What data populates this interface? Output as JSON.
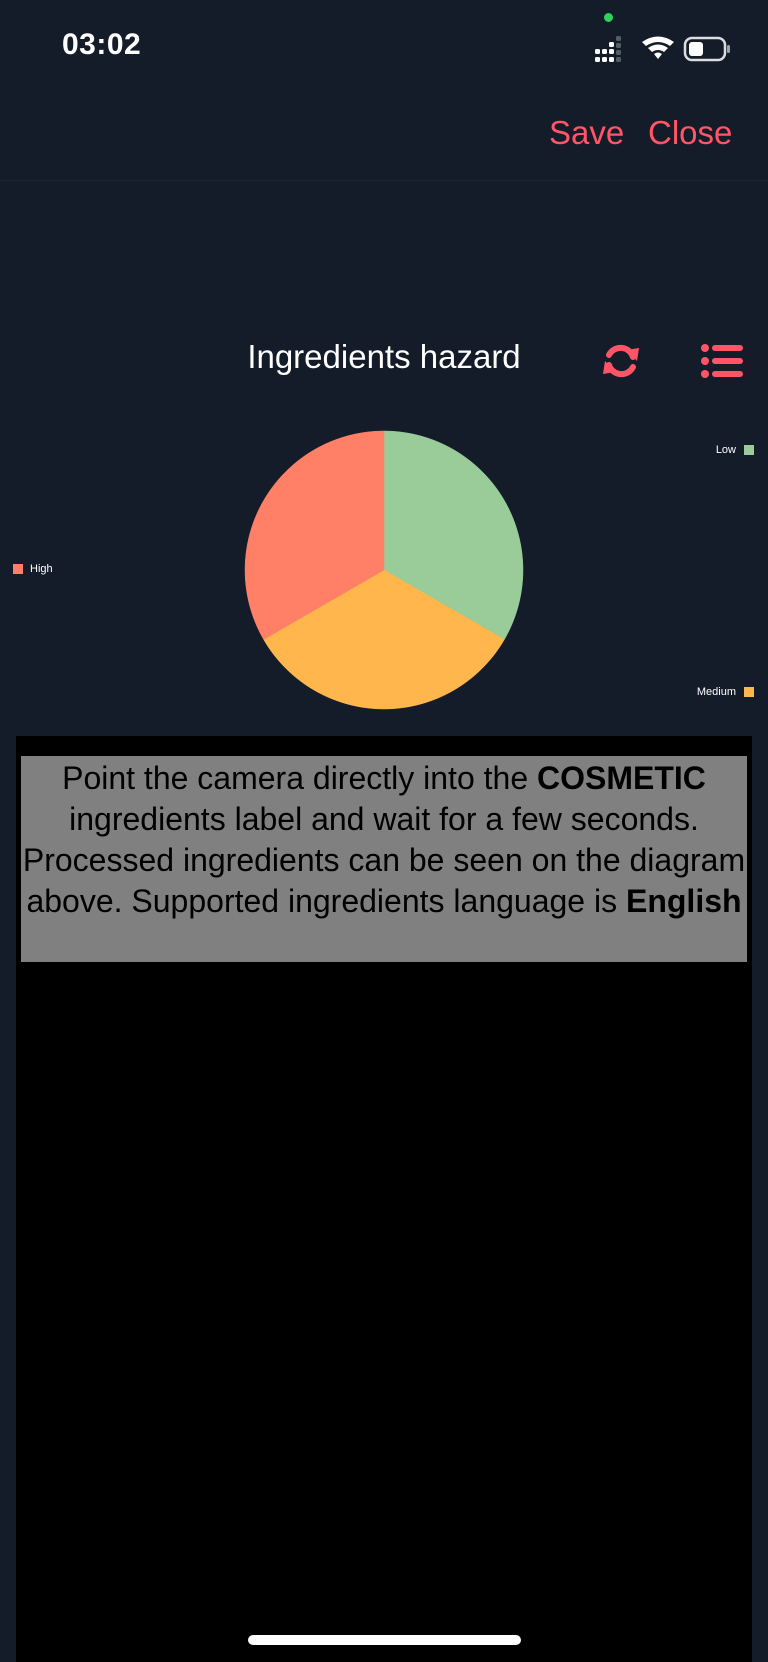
{
  "status_bar": {
    "time": "03:02",
    "icons": [
      "cellular-signal-icon",
      "wifi-icon",
      "battery-icon"
    ]
  },
  "nav": {
    "save_label": "Save",
    "close_label": "Close",
    "accent_color": "#ff5566"
  },
  "chart_header": {
    "title": "Ingredients hazard",
    "icons": [
      "refresh-icon",
      "list-icon"
    ]
  },
  "chart_data": {
    "type": "pie",
    "title": "Ingredients hazard",
    "slices": [
      {
        "label": "Low",
        "value": 1,
        "color": "#99cc99"
      },
      {
        "label": "Medium",
        "value": 1,
        "color": "#ffb64d"
      },
      {
        "label": "High",
        "value": 1,
        "color": "#ff8066"
      }
    ],
    "legend": [
      "High",
      "Low",
      "Medium"
    ]
  },
  "hint": {
    "part1": "Point the camera directly into the ",
    "bold1": "COSMETIC",
    "part2": " ingredients label and wait for a few seconds. Processed ingredients can be seen on the diagram above. Supported ingredients language is ",
    "bold2": "English"
  }
}
